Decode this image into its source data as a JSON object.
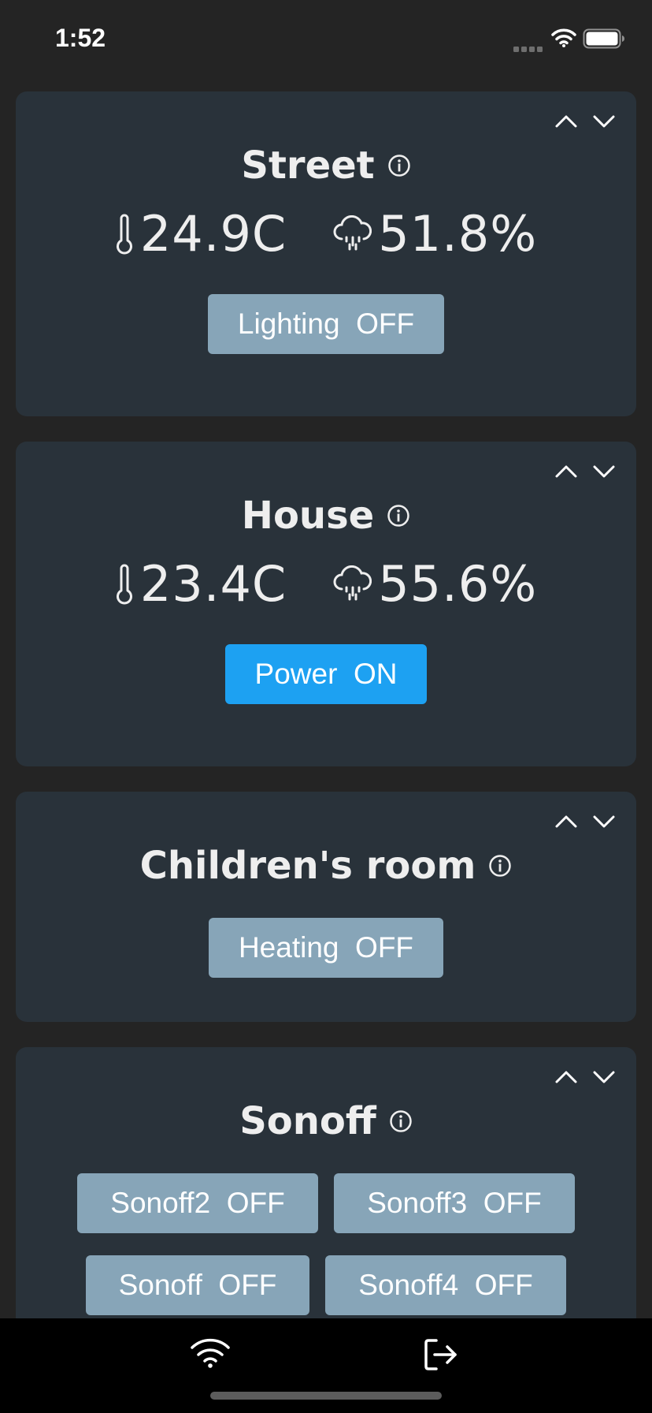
{
  "status_bar": {
    "time": "1:52",
    "signal_icon": "signal-dots-icon",
    "wifi_icon": "wifi-icon",
    "battery_icon": "battery-icon"
  },
  "colors": {
    "background": "#242424",
    "card": "#29323a",
    "button_off": "#87a5b8",
    "button_on": "#1da1f2",
    "text": "#eeeeee",
    "tab_bar": "#000000"
  },
  "cards": [
    {
      "title": "Street",
      "temperature": "24.9C",
      "humidity": "51.8%",
      "buttons": [
        {
          "label": "Lighting  OFF",
          "state": "off"
        }
      ]
    },
    {
      "title": "House",
      "temperature": "23.4C",
      "humidity": "55.6%",
      "buttons": [
        {
          "label": "Power  ON",
          "state": "on"
        }
      ]
    },
    {
      "title": "Children's room",
      "buttons": [
        {
          "label": "Heating  OFF",
          "state": "off"
        }
      ]
    },
    {
      "title": "Sonoff",
      "buttons": [
        {
          "label": "Sonoff2  OFF",
          "state": "off"
        },
        {
          "label": "Sonoff3  OFF",
          "state": "off"
        },
        {
          "label": "Sonoff  OFF",
          "state": "off"
        },
        {
          "label": "Sonoff4  OFF",
          "state": "off"
        }
      ]
    }
  ],
  "tab_bar": {
    "items": [
      {
        "icon": "wifi-icon"
      },
      {
        "icon": "logout-icon"
      }
    ]
  }
}
